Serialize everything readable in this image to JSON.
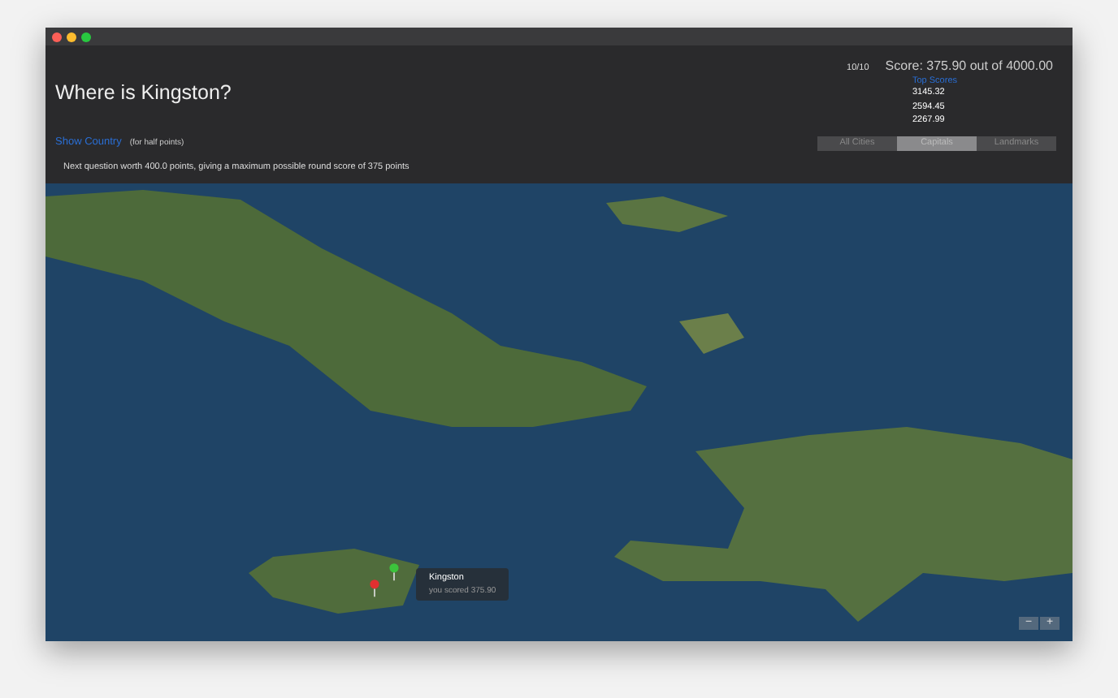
{
  "question": "Where is Kingston?",
  "show_country": {
    "link": "Show Country",
    "note": "(for half points)"
  },
  "next_question": "Next question worth 400.0 points, giving a maximum possible round score of 375 points",
  "progress": "10/10",
  "score": "Score: 375.90 out of 4000.00",
  "top_scores": {
    "title": "Top Scores",
    "values": [
      "3145.32",
      "2594.45",
      "2267.99"
    ]
  },
  "categories": [
    {
      "label": "All Cities",
      "selected": false
    },
    {
      "label": "Capitals",
      "selected": true
    },
    {
      "label": "Landmarks",
      "selected": false
    }
  ],
  "map": {
    "callout": {
      "title": "Kingston",
      "subtitle": "you scored 375.90"
    },
    "zoom_out": "−",
    "zoom_in": "+"
  }
}
